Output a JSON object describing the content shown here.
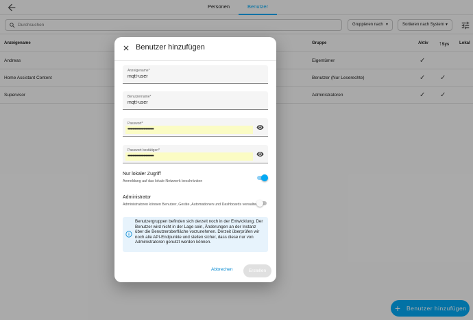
{
  "tabs": [
    {
      "label": "Personen"
    },
    {
      "label": "Benutzer"
    }
  ],
  "toolbar": {
    "search_placeholder": "Durchsuchen",
    "group_by_label": "Gruppieren nach",
    "sort_label": "Sortieren nach System"
  },
  "table": {
    "headers": {
      "name": "Anzeigename",
      "gruppe": "Gruppe",
      "aktiv": "Aktiv",
      "sys": "Sys",
      "lokal": "Lokal"
    },
    "rows": [
      {
        "name": "Andreas",
        "group": "Eigentümer",
        "active": "✓",
        "system": ""
      },
      {
        "name": "Home Assistant Content",
        "group": "Benutzer (Nur Leserechte)",
        "active": "✓",
        "system": "✓"
      },
      {
        "name": "Supervisor",
        "group": "Administratoren",
        "active": "✓",
        "system": "✓"
      }
    ]
  },
  "dialog": {
    "title": "Benutzer hinzufügen",
    "fields": {
      "display_name": {
        "label": "Anzeigename*",
        "value": "mqtt-user"
      },
      "username": {
        "label": "Benutzername*",
        "value": "mqtt-user"
      },
      "password": {
        "label": "Passwort*",
        "value": "••••••••••••••••••••••••••"
      },
      "confirm_password": {
        "label": "Passwort bestätigen*",
        "value": "••••••••••••••••••••••••••"
      }
    },
    "local_access": {
      "title": "Nur lokaler Zugriff",
      "subtitle": "Anmeldung auf das lokale Netzwerk beschränken",
      "enabled": true
    },
    "administrator": {
      "title": "Administrator",
      "subtitle": "Administratoren können Benutzer, Geräte, Automationen und Dashboards verwalten.",
      "enabled": false
    },
    "alert_text": "Benutzergruppen befinden sich derzeit noch in der Entwicklung. Der Benutzer wird nicht in der Lage sein, Änderungen an der Instanz über die Benutzeroberfläche vorzunehmen. Derzeit überprüfen wir noch alle API-Endpunkte und stellen sicher, dass diese nur von Administratoren genutzt werden können.",
    "cancel_label": "Abbrechen",
    "create_label": "Erstellen"
  },
  "fab": {
    "label": "Benutzer hinzufügen"
  },
  "colors": {
    "accent": "#03a9f4",
    "autofill": "#fbfcc4",
    "alert_bg": "#e7f3fc"
  }
}
